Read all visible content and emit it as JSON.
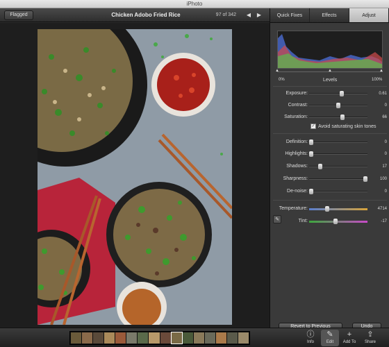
{
  "window": {
    "title": "iPhoto"
  },
  "toolbar": {
    "flagged_label": "Flagged",
    "photo_title": "Chicken Adobo Fried Rice",
    "counter": "97 of 342"
  },
  "tabs": [
    {
      "label": "Quick Fixes"
    },
    {
      "label": "Effects"
    },
    {
      "label": "Adjust",
      "active": true
    }
  ],
  "levels": {
    "label": "Levels",
    "left_label": "0%",
    "right_label": "100%"
  },
  "adjustments": {
    "exposure": {
      "label": "Exposure:",
      "value": "0.61",
      "level": 0.56
    },
    "contrast": {
      "label": "Contrast:",
      "value": "0",
      "level": 0.5
    },
    "saturation": {
      "label": "Saturation:",
      "value": "66",
      "level": 0.58
    },
    "skin_tones": {
      "label": "Avoid saturating skin tones",
      "checked": true
    },
    "definition": {
      "label": "Definition:",
      "value": "0",
      "level": 0.0
    },
    "highlights": {
      "label": "Highlights:",
      "value": "0",
      "level": 0.0
    },
    "shadows": {
      "label": "Shadows:",
      "value": "17",
      "level": 0.17
    },
    "sharpness": {
      "label": "Sharpness:",
      "value": "100",
      "level": 1.0
    },
    "denoise": {
      "label": "De-noise:",
      "value": "0",
      "level": 0.0
    },
    "temperature": {
      "label": "Temperature:",
      "value": "4714",
      "level": 0.3
    },
    "tint": {
      "label": "Tint:",
      "value": "-17",
      "level": 0.45
    }
  },
  "buttons": {
    "revert": "Revert to Previous",
    "undo": "Undo"
  },
  "bottom_tools": [
    {
      "icon": "info-icon",
      "glyph": "ⓘ",
      "label": "Info"
    },
    {
      "icon": "pencil-icon",
      "glyph": "✎",
      "label": "Edit",
      "active": true
    },
    {
      "icon": "plus-icon",
      "glyph": "+",
      "label": "Add To"
    },
    {
      "icon": "share-icon",
      "glyph": "⇪",
      "label": "Share"
    }
  ],
  "colors": {
    "panel_bg": "#3a3a3a",
    "temperature_gradient": [
      "#5a7fd0",
      "#d8a43a"
    ],
    "tint_gradient": [
      "#3ca83c",
      "#c84ac8"
    ]
  }
}
